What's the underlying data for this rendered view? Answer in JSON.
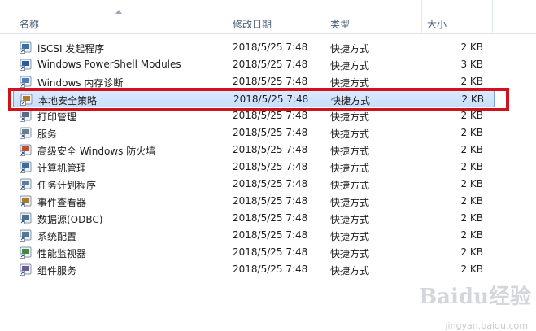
{
  "columns": {
    "name": "名称",
    "date": "修改日期",
    "type": "类型",
    "size": "大小"
  },
  "files": [
    {
      "name": "iSCSI 发起程序",
      "date": "2018/5/25 7:48",
      "type": "快捷方式",
      "size": "2 KB",
      "icon": "iscsi-icon"
    },
    {
      "name": "Windows PowerShell Modules",
      "date": "2018/5/25 7:48",
      "type": "快捷方式",
      "size": "3 KB",
      "icon": "powershell-icon"
    },
    {
      "name": "Windows 内存诊断",
      "date": "2018/5/25 7:48",
      "type": "快捷方式",
      "size": "2 KB",
      "icon": "memory-diagnostic-icon"
    },
    {
      "name": "本地安全策略",
      "date": "2018/5/25 7:48",
      "type": "快捷方式",
      "size": "2 KB",
      "icon": "security-policy-icon",
      "selected": true
    },
    {
      "name": "打印管理",
      "date": "2018/5/25 7:48",
      "type": "快捷方式",
      "size": "2 KB",
      "icon": "printer-icon"
    },
    {
      "name": "服务",
      "date": "2018/5/25 7:48",
      "type": "快捷方式",
      "size": "2 KB",
      "icon": "services-icon"
    },
    {
      "name": "高级安全 Windows 防火墙",
      "date": "2018/5/25 7:48",
      "type": "快捷方式",
      "size": "2 KB",
      "icon": "firewall-icon"
    },
    {
      "name": "计算机管理",
      "date": "2018/5/25 7:48",
      "type": "快捷方式",
      "size": "2 KB",
      "icon": "computer-management-icon"
    },
    {
      "name": "任务计划程序",
      "date": "2018/5/25 7:48",
      "type": "快捷方式",
      "size": "2 KB",
      "icon": "task-scheduler-icon"
    },
    {
      "name": "事件查看器",
      "date": "2018/5/25 7:48",
      "type": "快捷方式",
      "size": "2 KB",
      "icon": "event-viewer-icon"
    },
    {
      "name": "数据源(ODBC)",
      "date": "2018/5/25 7:48",
      "type": "快捷方式",
      "size": "2 KB",
      "icon": "odbc-icon"
    },
    {
      "name": "系统配置",
      "date": "2018/5/25 7:48",
      "type": "快捷方式",
      "size": "2 KB",
      "icon": "system-config-icon"
    },
    {
      "name": "性能监视器",
      "date": "2018/5/25 7:48",
      "type": "快捷方式",
      "size": "2 KB",
      "icon": "performance-monitor-icon"
    },
    {
      "name": "组件服务",
      "date": "2018/5/25 7:48",
      "type": "快捷方式",
      "size": "2 KB",
      "icon": "component-services-icon"
    }
  ],
  "watermark": {
    "brand": "Baidu经验",
    "url": "jingyan.baidu.com"
  },
  "colors": {
    "highlight_border": "#d0121b",
    "selection": "#c7dffc"
  }
}
